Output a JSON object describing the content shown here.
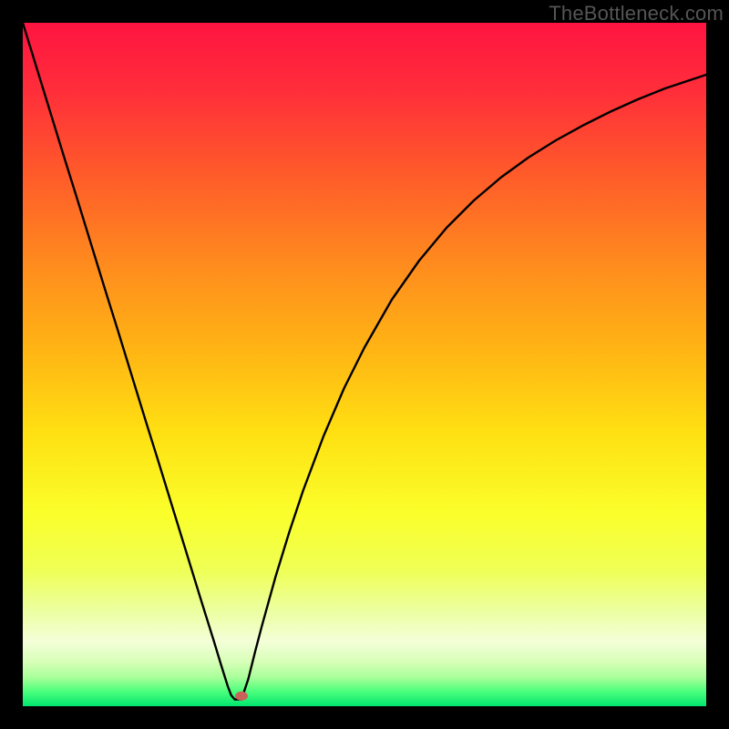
{
  "watermark": "TheBottleneck.com",
  "chart_data": {
    "type": "line",
    "title": "",
    "xlabel": "",
    "ylabel": "",
    "xlim": [
      0,
      1
    ],
    "ylim": [
      0,
      1
    ],
    "notch_x": 0.31,
    "marker": {
      "x": 0.32,
      "y": 0.015,
      "color": "#c9625b"
    },
    "gradient_stops": [
      {
        "offset": 0.0,
        "color": "#ff1441"
      },
      {
        "offset": 0.1,
        "color": "#ff2e3a"
      },
      {
        "offset": 0.22,
        "color": "#ff5a2a"
      },
      {
        "offset": 0.35,
        "color": "#ff8a1e"
      },
      {
        "offset": 0.48,
        "color": "#ffb514"
      },
      {
        "offset": 0.6,
        "color": "#ffe012"
      },
      {
        "offset": 0.72,
        "color": "#faff2b"
      },
      {
        "offset": 0.8,
        "color": "#efff55"
      },
      {
        "offset": 0.86,
        "color": "#ecffa0"
      },
      {
        "offset": 0.905,
        "color": "#f4ffd8"
      },
      {
        "offset": 0.935,
        "color": "#d8ffb8"
      },
      {
        "offset": 0.958,
        "color": "#a8ff9a"
      },
      {
        "offset": 0.978,
        "color": "#4dff7d"
      },
      {
        "offset": 1.0,
        "color": "#00e66e"
      }
    ],
    "series": [
      {
        "name": "bottleneck-curve",
        "x": [
          0.0,
          0.02,
          0.04,
          0.06,
          0.08,
          0.1,
          0.12,
          0.14,
          0.16,
          0.18,
          0.2,
          0.22,
          0.24,
          0.26,
          0.27,
          0.28,
          0.29,
          0.295,
          0.3,
          0.305,
          0.31,
          0.315,
          0.32,
          0.33,
          0.34,
          0.35,
          0.37,
          0.39,
          0.41,
          0.44,
          0.47,
          0.5,
          0.54,
          0.58,
          0.62,
          0.66,
          0.7,
          0.74,
          0.78,
          0.82,
          0.86,
          0.9,
          0.94,
          0.97,
          1.0
        ],
        "y": [
          1.0,
          0.935,
          0.87,
          0.805,
          0.741,
          0.676,
          0.611,
          0.547,
          0.482,
          0.417,
          0.353,
          0.288,
          0.223,
          0.158,
          0.126,
          0.094,
          0.061,
          0.045,
          0.029,
          0.016,
          0.01,
          0.01,
          0.01,
          0.04,
          0.08,
          0.118,
          0.19,
          0.255,
          0.315,
          0.395,
          0.465,
          0.525,
          0.595,
          0.652,
          0.7,
          0.74,
          0.774,
          0.803,
          0.828,
          0.85,
          0.87,
          0.888,
          0.904,
          0.914,
          0.924
        ]
      }
    ]
  }
}
